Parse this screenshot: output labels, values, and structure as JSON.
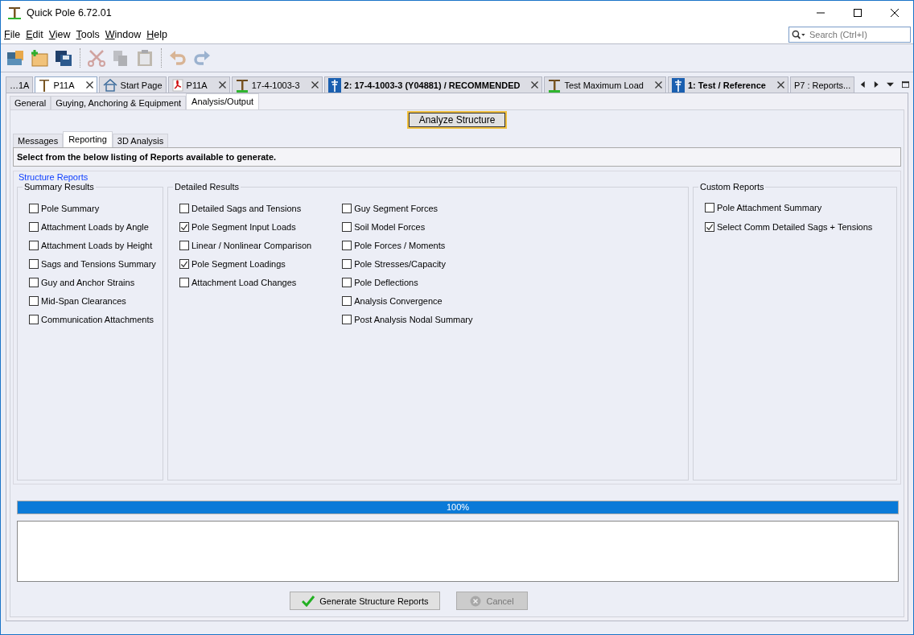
{
  "window": {
    "title": "Quick Pole 6.72.01"
  },
  "menu": [
    "File",
    "Edit",
    "View",
    "Tools",
    "Window",
    "Help"
  ],
  "search": {
    "placeholder": "Search (Ctrl+I)"
  },
  "toolbar": [
    {
      "kind": "open",
      "disabled": false
    },
    {
      "kind": "new",
      "disabled": false
    },
    {
      "kind": "save",
      "disabled": false
    },
    {
      "kind": "sep"
    },
    {
      "kind": "cut",
      "disabled": true
    },
    {
      "kind": "copy",
      "disabled": true
    },
    {
      "kind": "paste",
      "disabled": true
    },
    {
      "kind": "sep"
    },
    {
      "kind": "undo",
      "disabled": true
    },
    {
      "kind": "redo",
      "disabled": true
    }
  ],
  "doc_tabs": [
    {
      "label": "…1A",
      "kind": "plain",
      "bold": false,
      "selected": false,
      "closable": false
    },
    {
      "label": "P11A",
      "kind": "pole",
      "bold": false,
      "selected": true,
      "closable": true
    },
    {
      "label": "Start Page",
      "kind": "home",
      "bold": false,
      "selected": false,
      "closable": false
    },
    {
      "label": "P11A",
      "kind": "pdf",
      "bold": false,
      "selected": false,
      "closable": true
    },
    {
      "label": "17-4-1003-3",
      "kind": "pole-grass",
      "bold": false,
      "selected": false,
      "closable": true
    },
    {
      "label": "2: 17-4-1003-3 (Y04881) / RECOMMENDED",
      "kind": "tower",
      "bold": true,
      "selected": false,
      "closable": true
    },
    {
      "label": "Test Maximum Load",
      "kind": "pole-grass",
      "bold": false,
      "selected": false,
      "closable": true
    },
    {
      "label": "1: Test / Reference",
      "kind": "tower",
      "bold": true,
      "selected": false,
      "closable": true
    },
    {
      "label": "P7 : Reports...",
      "kind": "plain",
      "bold": false,
      "selected": false,
      "closable": false
    }
  ],
  "sub_tabs": [
    {
      "label": "General",
      "selected": false
    },
    {
      "label": "Guying, Anchoring & Equipment",
      "selected": false
    },
    {
      "label": "Analysis/Output",
      "selected": true
    }
  ],
  "analyze_button": "Analyze Structure",
  "inner_tabs": [
    {
      "label": "Messages",
      "selected": false
    },
    {
      "label": "Reporting",
      "selected": true
    },
    {
      "label": "3D Analysis",
      "selected": false
    }
  ],
  "instruction": "Select from the below listing of Reports available to generate.",
  "reports_title": "Structure Reports",
  "summary": {
    "title": "Summary Results",
    "items": [
      {
        "label": "Pole Summary",
        "checked": false
      },
      {
        "label": "Attachment Loads by Angle",
        "checked": false
      },
      {
        "label": "Attachment Loads by Height",
        "checked": false
      },
      {
        "label": "Sags and Tensions Summary",
        "checked": false
      },
      {
        "label": "Guy and Anchor Strains",
        "checked": false
      },
      {
        "label": "Mid-Span Clearances",
        "checked": false
      },
      {
        "label": "Communication Attachments",
        "checked": false
      }
    ]
  },
  "detailed": {
    "title": "Detailed Results",
    "columns": [
      [
        {
          "label": "Detailed Sags and Tensions",
          "checked": false
        },
        {
          "label": "Pole Segment Input Loads",
          "checked": true
        },
        {
          "label": "Linear / Nonlinear Comparison",
          "checked": false
        },
        {
          "label": "Pole Segment Loadings",
          "checked": true
        },
        {
          "label": "Attachment Load Changes",
          "checked": false
        }
      ],
      [
        {
          "label": "Guy Segment Forces",
          "checked": false
        },
        {
          "label": "Soil Model Forces",
          "checked": false
        },
        {
          "label": "Pole Forces / Moments",
          "checked": false
        },
        {
          "label": "Pole Stresses/Capacity",
          "checked": false
        },
        {
          "label": "Pole Deflections",
          "checked": false
        },
        {
          "label": "Analysis Convergence",
          "checked": false
        },
        {
          "label": "Post Analysis Nodal Summary",
          "checked": false
        }
      ]
    ]
  },
  "custom": {
    "title": "Custom Reports",
    "items": [
      {
        "label": "Pole Attachment Summary",
        "checked": false
      },
      {
        "label": "Select Comm Detailed Sags + Tensions",
        "checked": true
      }
    ]
  },
  "progress": {
    "level": 1,
    "reading": "100%"
  },
  "buttons": [
    {
      "label": "Generate Structure Reports",
      "kind": "generate",
      "disabled": false
    },
    {
      "label": "Cancel",
      "kind": "cancel",
      "disabled": true
    }
  ]
}
